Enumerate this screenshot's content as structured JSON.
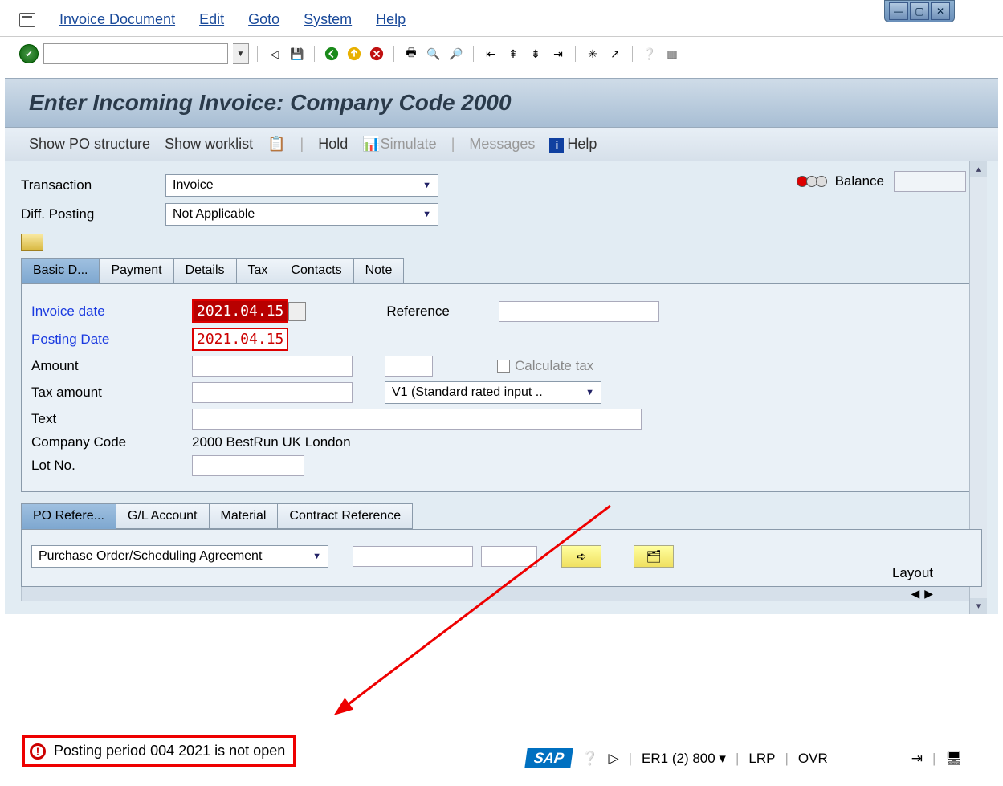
{
  "menubar": {
    "items": [
      "Invoice Document",
      "Edit",
      "Goto",
      "System",
      "Help"
    ]
  },
  "title": "Enter Incoming Invoice: Company Code 2000",
  "app_toolbar": {
    "show_po": "Show PO structure",
    "show_worklist": "Show worklist",
    "hold": "Hold",
    "simulate": "Simulate",
    "messages": "Messages",
    "help": "Help"
  },
  "header": {
    "transaction_lbl": "Transaction",
    "transaction_val": "Invoice",
    "diff_posting_lbl": "Diff. Posting",
    "diff_posting_val": "Not Applicable",
    "balance_lbl": "Balance",
    "balance_val": ""
  },
  "tabs": [
    "Basic D...",
    "Payment",
    "Details",
    "Tax",
    "Contacts",
    "Note"
  ],
  "basic": {
    "invoice_date_lbl": "Invoice date",
    "invoice_date_val": "2021.04.15",
    "reference_lbl": "Reference",
    "reference_val": "",
    "posting_date_lbl": "Posting Date",
    "posting_date_val": "2021.04.15",
    "amount_lbl": "Amount",
    "amount_val": "",
    "calc_tax_lbl": "Calculate tax",
    "tax_amount_lbl": "Tax amount",
    "tax_amount_val": "",
    "tax_code_val": "V1 (Standard rated input ..",
    "text_lbl": "Text",
    "text_val": "",
    "company_code_lbl": "Company Code",
    "company_code_val": "2000 BestRun UK London",
    "lot_no_lbl": "Lot No.",
    "lot_no_val": ""
  },
  "tabs2": [
    "PO Refere...",
    "G/L Account",
    "Material",
    "Contract Reference"
  ],
  "po_ref": {
    "type": "Purchase Order/Scheduling Agreement",
    "field1": "",
    "field2": ""
  },
  "layout_lbl": "Layout",
  "status_message": "Posting period 004 2021 is not open",
  "statusbar": {
    "system": "ER1 (2) 800",
    "user": "LRP",
    "mode": "OVR"
  }
}
